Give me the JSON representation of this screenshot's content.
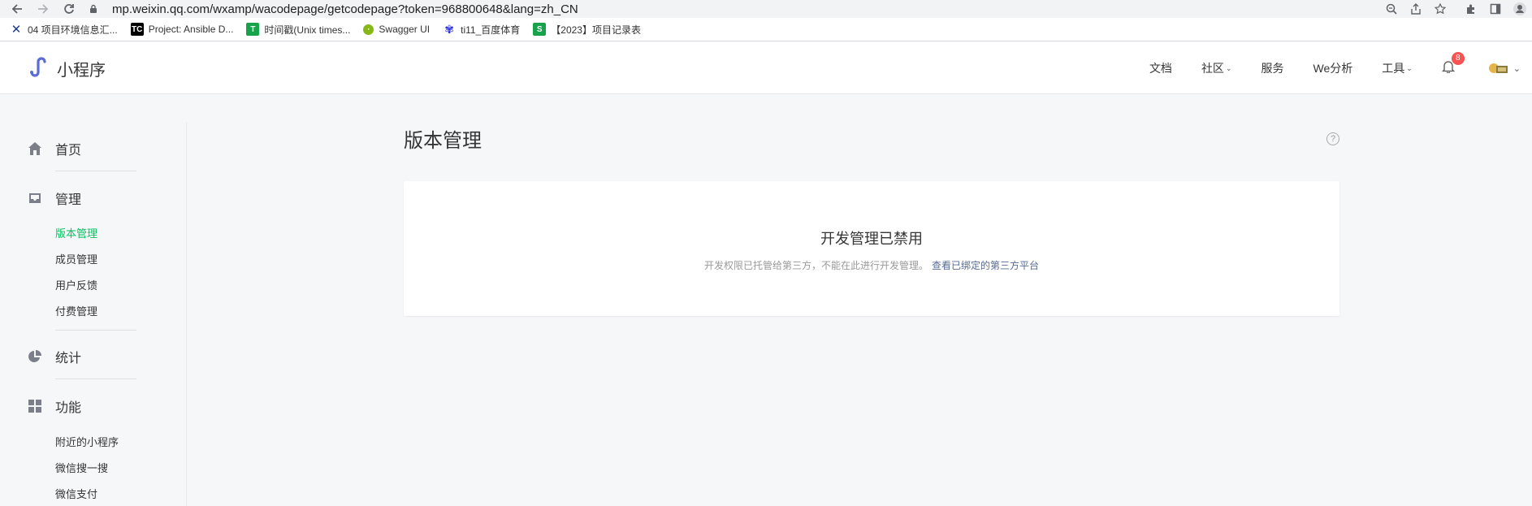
{
  "browser": {
    "url": "mp.weixin.qq.com/wxamp/wacodepage/getcodepage?token=968800648&lang=zh_CN",
    "bookmarks": [
      {
        "label": "04 项目环境信息汇..."
      },
      {
        "label": "Project: Ansible D..."
      },
      {
        "label": "时间戳(Unix times..."
      },
      {
        "label": "Swagger UI"
      },
      {
        "label": "ti11_百度体育"
      },
      {
        "label": "【2023】项目记录表"
      }
    ]
  },
  "header": {
    "logo_text": "小程序",
    "nav": {
      "docs": "文档",
      "community": "社区",
      "service": "服务",
      "analytics": "We分析",
      "tools": "工具"
    },
    "notification_count": "8"
  },
  "sidebar": {
    "home": "首页",
    "manage": "管理",
    "manage_items": [
      "版本管理",
      "成员管理",
      "用户反馈",
      "付费管理"
    ],
    "stats": "统计",
    "features": "功能",
    "feature_items": [
      "附近的小程序",
      "微信搜一搜",
      "微信支付"
    ]
  },
  "main": {
    "title": "版本管理",
    "card_title": "开发管理已禁用",
    "card_desc": "开发权限已托管给第三方，不能在此进行开发管理。",
    "card_link": "查看已绑定的第三方平台"
  },
  "colors": {
    "accent": "#07c160",
    "link": "#576b95",
    "badge": "#fa5151"
  }
}
